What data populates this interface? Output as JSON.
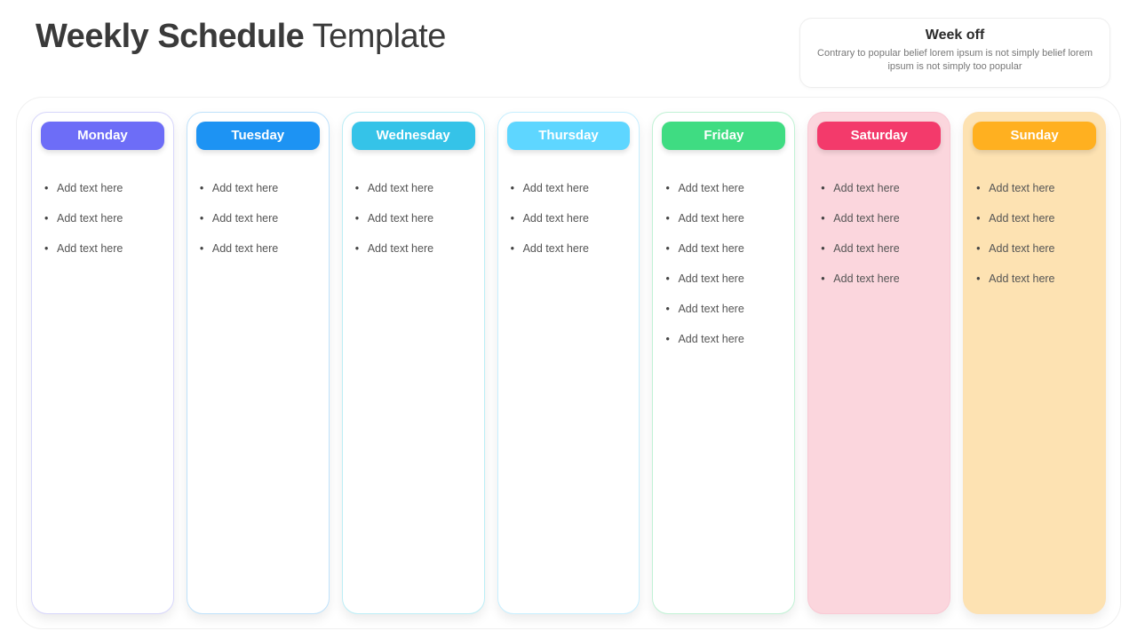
{
  "header": {
    "title_bold": "Weekly Schedule",
    "title_light": " Template",
    "note_title": "Week off",
    "note_body": "Contrary to popular belief lorem ipsum is not simply belief lorem ipsum is not simply too popular"
  },
  "placeholder": "Add text here",
  "days": [
    {
      "id": "monday",
      "label": "Monday",
      "pill": "#6d6df7",
      "border": "#d7d6fb",
      "bg": "#ffffff",
      "count": 3
    },
    {
      "id": "tuesday",
      "label": "Tuesday",
      "pill": "#1d93f3",
      "border": "#bfe2fb",
      "bg": "#ffffff",
      "count": 3
    },
    {
      "id": "wednesday",
      "label": "Wednesday",
      "pill": "#35c3e8",
      "border": "#bceef6",
      "bg": "#ffffff",
      "count": 3
    },
    {
      "id": "thursday",
      "label": "Thursday",
      "pill": "#5ed6ff",
      "border": "#c7efff",
      "bg": "#ffffff",
      "count": 3
    },
    {
      "id": "friday",
      "label": "Friday",
      "pill": "#3fdc82",
      "border": "#c1f2d5",
      "bg": "#ffffff",
      "count": 6
    },
    {
      "id": "saturday",
      "label": "Saturday",
      "pill": "#f33a6b",
      "border": "#f9c9d4",
      "bg": "#fbd6dd",
      "count": 4
    },
    {
      "id": "sunday",
      "label": "Sunday",
      "pill": "#ffb020",
      "border": "#fde1b3",
      "bg": "#fde2b2",
      "count": 4
    }
  ]
}
